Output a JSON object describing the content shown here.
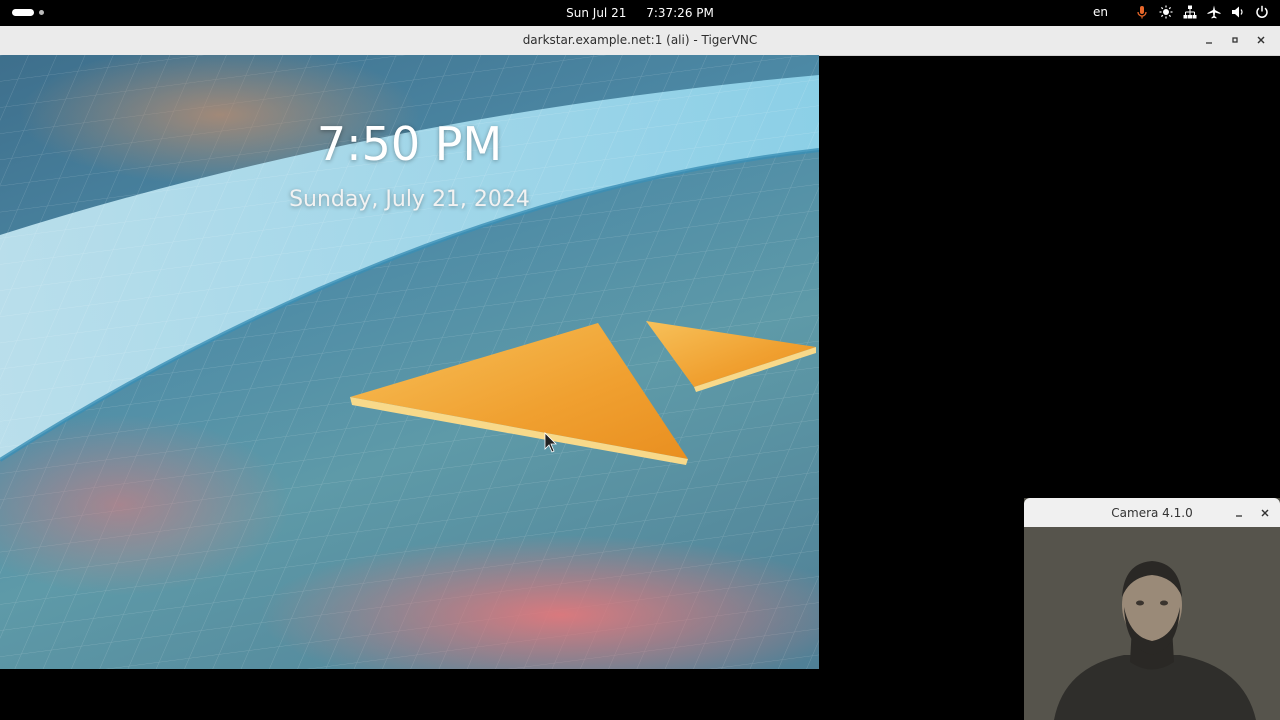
{
  "topbar": {
    "date": "Sun Jul 21",
    "time": "7:37:26 PM",
    "language": "en",
    "tray_icons": [
      "microphone-icon",
      "brightness-icon",
      "network-icon",
      "airplane-mode-icon",
      "volume-icon",
      "power-icon"
    ]
  },
  "vnc_window": {
    "title": "darkstar.example.net:1 (ali) - TigerVNC"
  },
  "remote_screen": {
    "lock_time": "7:50 PM",
    "lock_date": "Sunday, July 21, 2024"
  },
  "camera_window": {
    "title": "Camera 4.1.0"
  },
  "colors": {
    "accent_orange": "#f0a030",
    "mic_active": "#e8672a"
  }
}
